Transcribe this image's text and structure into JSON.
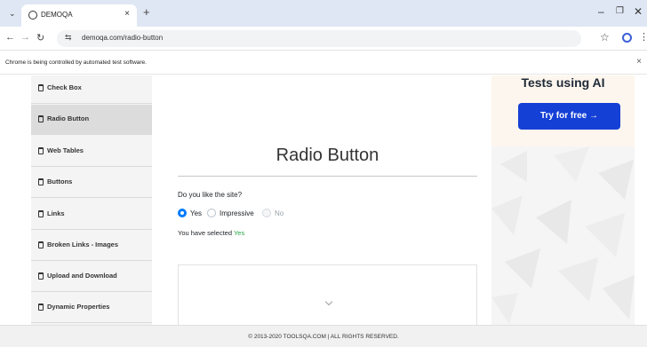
{
  "browser": {
    "tab_menu_glyph": "⌄",
    "tab_title": "DEMOQA",
    "tab_close_glyph": "×",
    "new_tab_glyph": "+",
    "url": "demoqa.com/radio-button",
    "infobar_text": "Chrome is being controlled by automated test software.",
    "infobar_close_glyph": "×",
    "icons": [
      "back-icon",
      "forward-icon",
      "reload-icon",
      "site-info-icon",
      "star-icon",
      "profile-icon",
      "more-icon"
    ]
  },
  "sidebar": {
    "items": [
      {
        "label": "Check Box"
      },
      {
        "label": "Radio Button",
        "active": true
      },
      {
        "label": "Web Tables"
      },
      {
        "label": "Buttons"
      },
      {
        "label": "Links"
      },
      {
        "label": "Broken Links - Images"
      },
      {
        "label": "Upload and Download"
      },
      {
        "label": "Dynamic Properties"
      }
    ]
  },
  "main": {
    "title": "Radio Button",
    "question": "Do you like the site?",
    "options": [
      {
        "label": "Yes",
        "checked": true,
        "disabled": false
      },
      {
        "label": "Impressive",
        "checked": false,
        "disabled": false
      },
      {
        "label": "No",
        "checked": false,
        "disabled": true
      }
    ],
    "result_prefix": "You have selected",
    "result_value": "Yes"
  },
  "promo": {
    "heading": "Tests using AI",
    "button_label": "Try for free →",
    "button_color": "#1540d6"
  },
  "footer": {
    "text": "© 2013-2020 TOOLSQA.COM | ALL RIGHTS RESERVED."
  },
  "colors": {
    "accent": "#007bff",
    "result_green": "#28a745"
  }
}
